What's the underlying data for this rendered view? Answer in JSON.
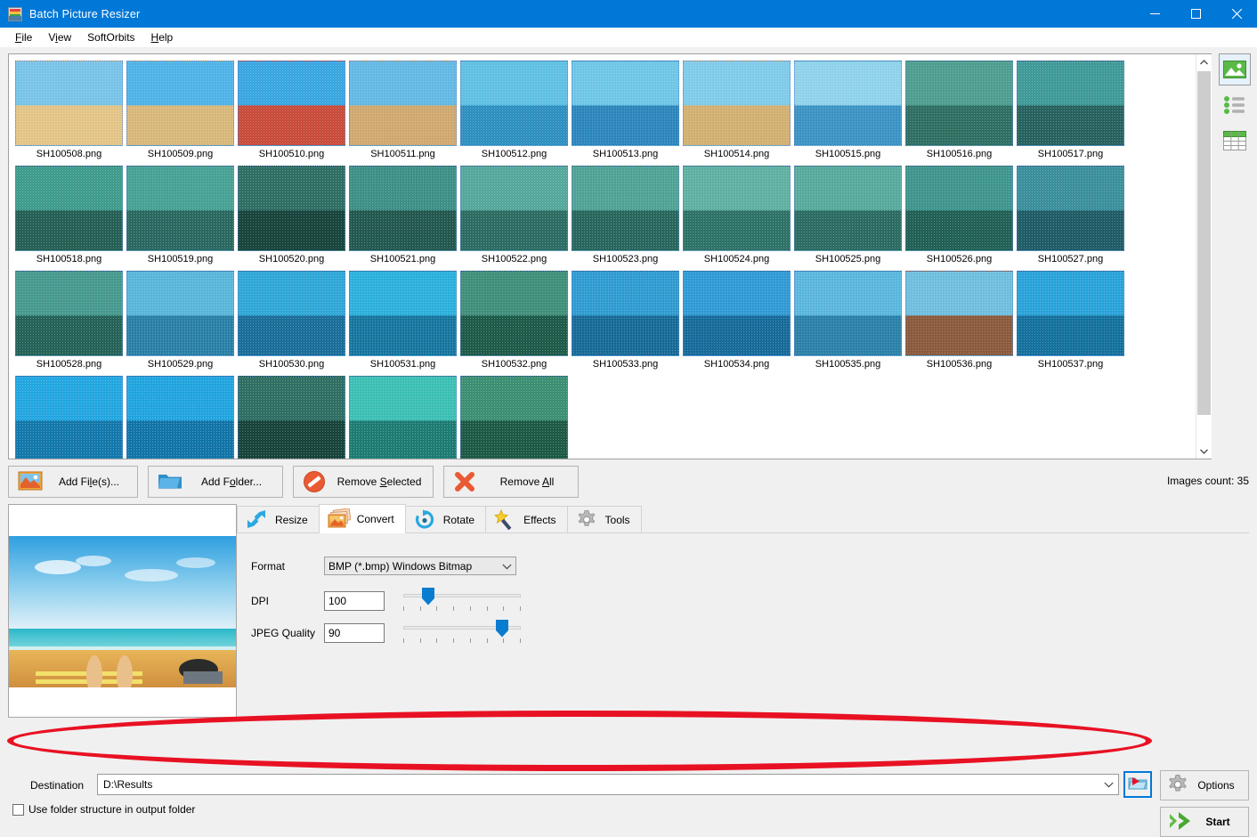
{
  "window": {
    "title": "Batch Picture Resizer",
    "icon": "app-logo-icon",
    "controls": {
      "minimize": "–",
      "maximize": "□",
      "close": "✕"
    }
  },
  "menubar": {
    "items": [
      {
        "label": "File",
        "accel": "F"
      },
      {
        "label": "View",
        "accel": "V"
      },
      {
        "label": "SoftOrbits",
        "accel": ""
      },
      {
        "label": "Help",
        "accel": "H"
      }
    ]
  },
  "view_rail": [
    {
      "name": "thumbnail-view",
      "label": "Thumbnails",
      "active": true
    },
    {
      "name": "list-view",
      "label": "List",
      "active": false
    },
    {
      "name": "details-view",
      "label": "Details",
      "active": false
    }
  ],
  "thumbnails": {
    "selected_all": true,
    "items": [
      {
        "file": "SH100508.png",
        "c1": "#79c3e8",
        "c2": "#e3c487"
      },
      {
        "file": "SH100509.png",
        "c1": "#4fb3e8",
        "c2": "#d8b77a"
      },
      {
        "file": "SH100510.png",
        "c1": "#3aa6e0",
        "c2": "#c94b3a"
      },
      {
        "file": "SH100511.png",
        "c1": "#63b9e4",
        "c2": "#cfa86f"
      },
      {
        "file": "SH100512.png",
        "c1": "#5fc0e2",
        "c2": "#2f8fc0"
      },
      {
        "file": "SH100513.png",
        "c1": "#6ec6e6",
        "c2": "#2c86bb"
      },
      {
        "file": "SH100514.png",
        "c1": "#7fcbe9",
        "c2": "#d2b071"
      },
      {
        "file": "SH100515.png",
        "c1": "#8fd2ea",
        "c2": "#3b93c4"
      },
      {
        "file": "SH100516.png",
        "c1": "#4e9e8f",
        "c2": "#2f6f62"
      },
      {
        "file": "SH100517.png",
        "c1": "#3f9a97",
        "c2": "#27625f"
      },
      {
        "file": "SH100518.png",
        "c1": "#3f9b8c",
        "c2": "#255f54"
      },
      {
        "file": "SH100519.png",
        "c1": "#47a194",
        "c2": "#2a6860"
      },
      {
        "file": "SH100520.png",
        "c1": "#2e6e63",
        "c2": "#17443c"
      },
      {
        "file": "SH100521.png",
        "c1": "#3d8f86",
        "c2": "#22584f"
      },
      {
        "file": "SH100522.png",
        "c1": "#55a89b",
        "c2": "#2c6c62"
      },
      {
        "file": "SH100523.png",
        "c1": "#4fa395",
        "c2": "#28665c"
      },
      {
        "file": "SH100524.png",
        "c1": "#5fb0a2",
        "c2": "#2e7267"
      },
      {
        "file": "SH100525.png",
        "c1": "#57aa9c",
        "c2": "#2b6c61"
      },
      {
        "file": "SH100526.png",
        "c1": "#3f958c",
        "c2": "#216055"
      },
      {
        "file": "SH100527.png",
        "c1": "#3b8f9c",
        "c2": "#1f5c66"
      },
      {
        "file": "SH100528.png",
        "c1": "#46998e",
        "c2": "#256258"
      },
      {
        "file": "SH100529.png",
        "c1": "#58b6d9",
        "c2": "#2a7fa6"
      },
      {
        "file": "SH100530.png",
        "c1": "#2fa7d6",
        "c2": "#1b6e99"
      },
      {
        "file": "SH100531.png",
        "c1": "#2bb0dc",
        "c2": "#17769f"
      },
      {
        "file": "SH100532.png",
        "c1": "#3f8f7a",
        "c2": "#1e5a49"
      },
      {
        "file": "SH100533.png",
        "c1": "#2f9bd0",
        "c2": "#186b96"
      },
      {
        "file": "SH100534.png",
        "c1": "#2f9ad4",
        "c2": "#176b9a"
      },
      {
        "file": "SH100535.png",
        "c1": "#5ab6dd",
        "c2": "#2b80a8"
      },
      {
        "file": "SH100536.png",
        "c1": "#6fbede",
        "c2": "#8a5a3c"
      },
      {
        "file": "SH100537.png",
        "c1": "#29a2d8",
        "c2": "#14709c"
      },
      {
        "file": "",
        "c1": "#23a6e0",
        "c2": "#1478ab"
      },
      {
        "file": "",
        "c1": "#21a4de",
        "c2": "#1275a8"
      },
      {
        "file": "",
        "c1": "#2f6f63",
        "c2": "#17443b"
      },
      {
        "file": "",
        "c1": "#3cbfb4",
        "c2": "#1d7c74"
      },
      {
        "file": "",
        "c1": "#3c8f72",
        "c2": "#1d5a46"
      }
    ]
  },
  "file_toolbar": {
    "buttons": [
      {
        "name": "add-files-button",
        "label": "Add File(s)...",
        "accel": "l",
        "icon": "picture-icon"
      },
      {
        "name": "add-folder-button",
        "label": "Add Folder...",
        "accel": "o",
        "icon": "folder-icon"
      },
      {
        "name": "remove-selected-button",
        "label": "Remove Selected",
        "accel": "S",
        "icon": "no-entry-icon"
      },
      {
        "name": "remove-all-button",
        "label": "Remove All",
        "accel": "A",
        "icon": "x-cross-icon"
      }
    ],
    "images_count": "Images count: 35"
  },
  "preview": {
    "name": "preview-image",
    "alt": "beach-photo"
  },
  "tabs": [
    {
      "label": "Resize",
      "icon": "resize-arrow-icon",
      "active": false
    },
    {
      "label": "Convert",
      "icon": "convert-images-icon",
      "active": true
    },
    {
      "label": "Rotate",
      "icon": "rotate-icon",
      "active": false
    },
    {
      "label": "Effects",
      "icon": "magic-wand-icon",
      "active": false
    },
    {
      "label": "Tools",
      "icon": "gear-icon",
      "active": false
    }
  ],
  "convert_panel": {
    "format": {
      "label": "Format",
      "value": "BMP (*.bmp) Windows Bitmap"
    },
    "dpi": {
      "label": "DPI",
      "value": "100",
      "slider_percent": 18
    },
    "jpeg_quality": {
      "label": "JPEG Quality",
      "value": "90",
      "slider_percent": 88
    }
  },
  "destination": {
    "label": "Destination",
    "value": "D:\\Results",
    "placeholder": "D:\\Results",
    "browse_icon": "browse-folder-icon",
    "use_folder_structure": {
      "label": "Use folder structure in output folder",
      "checked": false
    }
  },
  "action_buttons": {
    "options": {
      "label": "Options",
      "icon": "gear-icon"
    },
    "start": {
      "label": "Start",
      "icon": "green-arrow-icon"
    }
  },
  "annotation": {
    "shape": "ellipse",
    "color": "#e81123"
  }
}
